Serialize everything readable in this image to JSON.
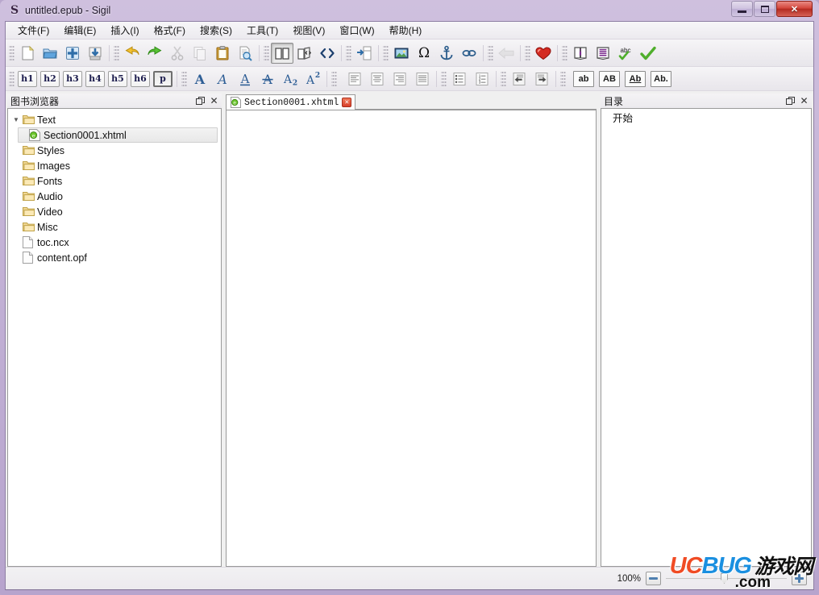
{
  "window": {
    "title": "untitled.epub - Sigil",
    "app_icon": "sigil-s-icon",
    "buttons": {
      "minimize": "minimize",
      "maximize": "maximize",
      "close": "✕"
    }
  },
  "menubar": {
    "items": [
      {
        "label": "文件(F)",
        "name": "menu-file"
      },
      {
        "label": "编辑(E)",
        "name": "menu-edit"
      },
      {
        "label": "插入(I)",
        "name": "menu-insert"
      },
      {
        "label": "格式(F)",
        "name": "menu-format"
      },
      {
        "label": "搜索(S)",
        "name": "menu-search"
      },
      {
        "label": "工具(T)",
        "name": "menu-tools"
      },
      {
        "label": "视图(V)",
        "name": "menu-view"
      },
      {
        "label": "窗口(W)",
        "name": "menu-window"
      },
      {
        "label": "帮助(H)",
        "name": "menu-help"
      }
    ]
  },
  "toolbar_main": {
    "groups": [
      {
        "buttons": [
          {
            "icon": "new-file-icon",
            "state": "normal"
          },
          {
            "icon": "open-folder-icon",
            "state": "normal"
          },
          {
            "icon": "add-file-icon",
            "state": "normal"
          },
          {
            "icon": "save-icon",
            "state": "normal"
          }
        ]
      },
      {
        "buttons": [
          {
            "icon": "undo-icon",
            "state": "normal"
          },
          {
            "icon": "redo-icon",
            "state": "normal"
          },
          {
            "icon": "cut-icon",
            "state": "disabled"
          },
          {
            "icon": "copy-icon",
            "state": "disabled"
          },
          {
            "icon": "paste-icon",
            "state": "normal"
          },
          {
            "icon": "find-replace-icon",
            "state": "normal"
          }
        ]
      },
      {
        "buttons": [
          {
            "icon": "book-view-icon",
            "state": "pressed"
          },
          {
            "icon": "split-view-icon",
            "state": "normal"
          },
          {
            "icon": "code-view-icon",
            "state": "normal"
          }
        ]
      },
      {
        "buttons": [
          {
            "icon": "split-file-icon",
            "state": "normal"
          }
        ]
      },
      {
        "buttons": [
          {
            "icon": "insert-image-icon",
            "state": "normal"
          },
          {
            "icon": "special-character-icon",
            "state": "normal"
          },
          {
            "icon": "insert-anchor-icon",
            "state": "normal"
          },
          {
            "icon": "insert-link-icon",
            "state": "normal"
          }
        ]
      },
      {
        "buttons": [
          {
            "icon": "back-arrow-icon",
            "state": "disabled"
          }
        ]
      },
      {
        "buttons": [
          {
            "icon": "heart-icon",
            "state": "normal"
          }
        ]
      },
      {
        "buttons": [
          {
            "icon": "metadata-editor-icon",
            "state": "normal"
          },
          {
            "icon": "toc-editor-icon",
            "state": "normal"
          },
          {
            "icon": "spellcheck-icon",
            "state": "normal"
          },
          {
            "icon": "validate-icon",
            "state": "normal"
          }
        ]
      }
    ],
    "special_character": "Ω",
    "spellcheck_label": "abc"
  },
  "toolbar_format": {
    "headings": [
      {
        "label": "h1",
        "state": "normal"
      },
      {
        "label": "h2",
        "state": "normal"
      },
      {
        "label": "h3",
        "state": "normal"
      },
      {
        "label": "h4",
        "state": "normal"
      },
      {
        "label": "h5",
        "state": "normal"
      },
      {
        "label": "h6",
        "state": "normal"
      },
      {
        "label": "p",
        "state": "pressed"
      }
    ],
    "text_styles": [
      {
        "icon": "bold-icon",
        "glyph": "A"
      },
      {
        "icon": "italic-icon",
        "glyph": "A"
      },
      {
        "icon": "underline-icon",
        "glyph": "A"
      },
      {
        "icon": "strikethrough-icon",
        "glyph": "A"
      },
      {
        "icon": "subscript-icon",
        "glyph": "A",
        "sub": "2"
      },
      {
        "icon": "superscript-icon",
        "glyph": "A",
        "sup": "2"
      }
    ],
    "alignments": [
      {
        "icon": "align-left-icon"
      },
      {
        "icon": "align-center-icon"
      },
      {
        "icon": "align-right-icon"
      },
      {
        "icon": "align-justify-icon"
      }
    ],
    "lists": [
      {
        "icon": "bullet-list-icon"
      },
      {
        "icon": "numbered-list-icon"
      }
    ],
    "indents": [
      {
        "icon": "outdent-icon"
      },
      {
        "icon": "indent-icon"
      }
    ],
    "case_buttons": [
      {
        "label": "ab",
        "name": "lowercase-button"
      },
      {
        "label": "AB",
        "name": "uppercase-button"
      },
      {
        "label": "Ab",
        "name": "titlecase-button"
      },
      {
        "label": "Ab.",
        "name": "sentencecase-button"
      }
    ]
  },
  "book_browser": {
    "title": "图书浏览器",
    "float_icon": "undock-icon",
    "close_icon": "✕",
    "tree": [
      {
        "label": "Text",
        "type": "folder",
        "expanded": true,
        "selected": false,
        "child": false
      },
      {
        "label": "Section0001.xhtml",
        "type": "xhtml",
        "expanded": false,
        "selected": true,
        "child": true
      },
      {
        "label": "Styles",
        "type": "folder",
        "expanded": false,
        "selected": false,
        "child": false
      },
      {
        "label": "Images",
        "type": "folder",
        "expanded": false,
        "selected": false,
        "child": false
      },
      {
        "label": "Fonts",
        "type": "folder",
        "expanded": false,
        "selected": false,
        "child": false
      },
      {
        "label": "Audio",
        "type": "folder",
        "expanded": false,
        "selected": false,
        "child": false
      },
      {
        "label": "Video",
        "type": "folder",
        "expanded": false,
        "selected": false,
        "child": false
      },
      {
        "label": "Misc",
        "type": "folder",
        "expanded": false,
        "selected": false,
        "child": false
      },
      {
        "label": "toc.ncx",
        "type": "file",
        "expanded": false,
        "selected": false,
        "child": false
      },
      {
        "label": "content.opf",
        "type": "file",
        "expanded": false,
        "selected": false,
        "child": false
      }
    ]
  },
  "editor": {
    "tab": {
      "label": "Section0001.xhtml",
      "icon": "xhtml-file-icon",
      "close": "✕",
      "active": true
    },
    "content": ""
  },
  "toc_panel": {
    "title": "目录",
    "float_icon": "undock-icon",
    "close_icon": "✕",
    "items": [
      {
        "label": "开始"
      }
    ]
  },
  "statusbar": {
    "zoom_label": "100%",
    "zoom_out": "–",
    "zoom_in": "+",
    "slider_value": 45
  },
  "watermark": {
    "uc": "UC",
    "bug": "BUG",
    "chinese": "游戏网",
    "domain": ".com"
  },
  "colors": {
    "frame": "#b7a4cd",
    "close_red": "#d3463c",
    "accent_blue": "#1a8fe0",
    "accent_orange": "#f04b24"
  }
}
